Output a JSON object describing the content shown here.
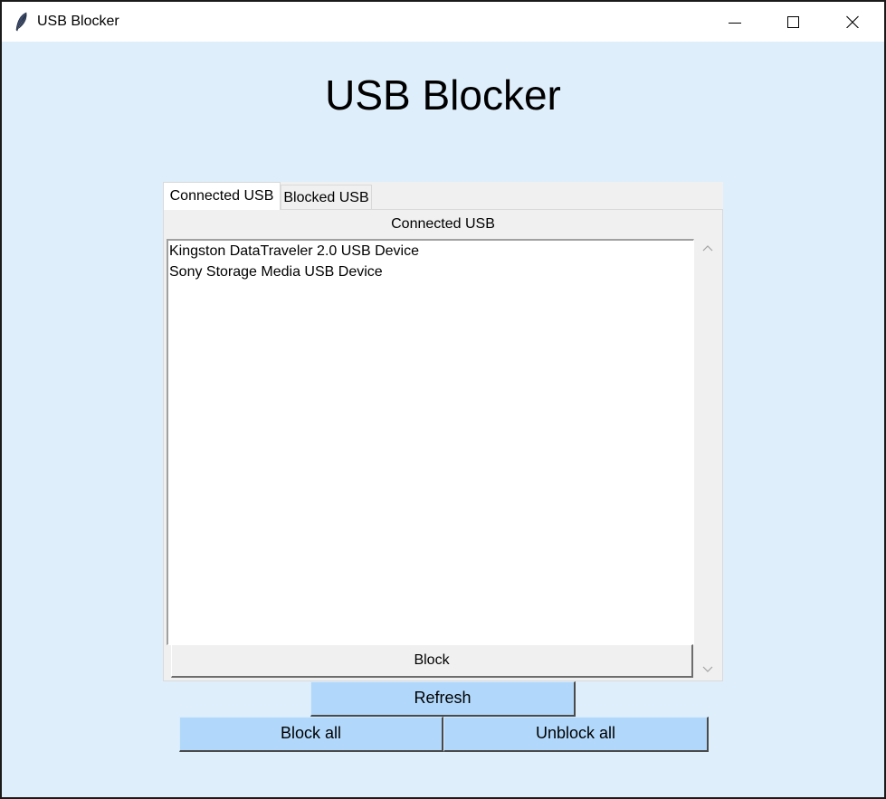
{
  "window": {
    "title": "USB Blocker",
    "app_icon": "feather-icon",
    "controls": [
      "minimize-icon",
      "maximize-icon",
      "close-icon"
    ],
    "background_color": "#deeefb"
  },
  "main": {
    "heading": "USB Blocker"
  },
  "notebook": {
    "tabs": [
      {
        "label": "Connected USB",
        "selected": true
      },
      {
        "label": "Blocked USB",
        "selected": false
      }
    ],
    "panel": {
      "label": "Connected USB",
      "devices": [
        "Kingston DataTraveler 2.0 USB Device",
        "Sony Storage Media USB Device"
      ],
      "block_label": "Block"
    }
  },
  "actions": {
    "refresh_label": "Refresh",
    "block_all_label": "Block all",
    "unblock_all_label": "Unblock all",
    "button_color": "#b1d8fb"
  }
}
